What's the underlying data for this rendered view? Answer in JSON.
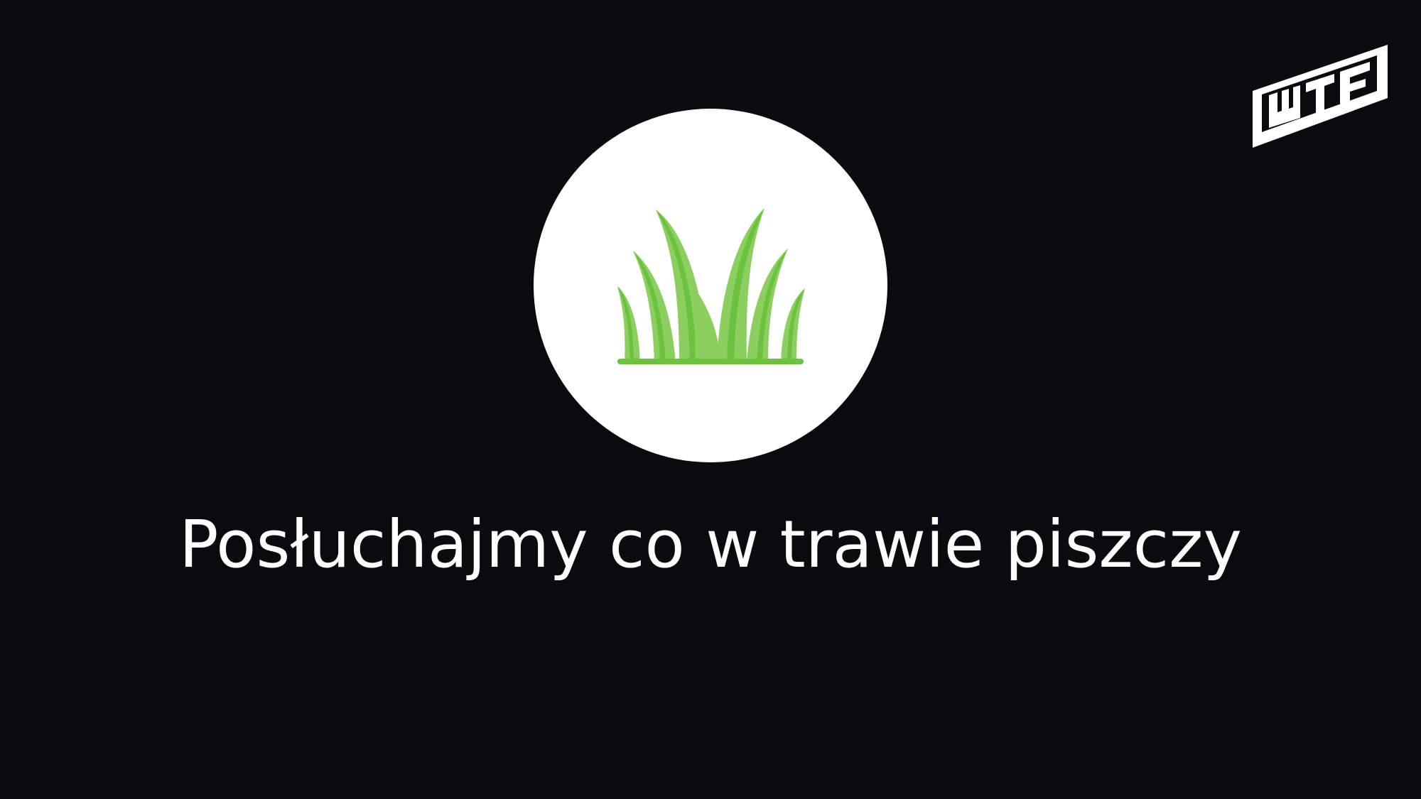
{
  "slide": {
    "caption": "Posłuchajmy co w trawie piszczy",
    "background_color": "#0b0a0f",
    "text_color": "#ffffff"
  },
  "logo": {
    "text": "WTF",
    "icon": "brand-logo-icon"
  },
  "illustration": {
    "icon": "grass-icon",
    "circle_color": "#ffffff",
    "grass_light": "#8ccf5f",
    "grass_dark": "#6cc23f"
  }
}
